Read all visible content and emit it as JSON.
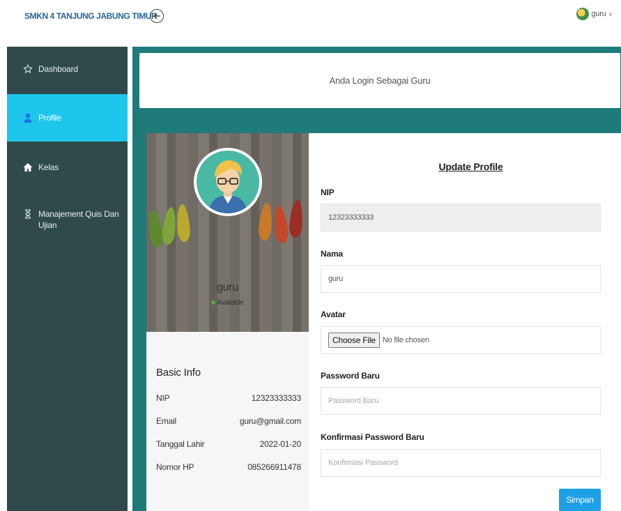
{
  "header": {
    "brand": "SMKN 4 TANJUNG JABUNG TIMUR",
    "back_icon": "back-arrow-circle-icon",
    "user_name": "guru",
    "caret": "∨"
  },
  "sidebar": {
    "items": [
      {
        "label": "Dashboard",
        "icon": "star-icon"
      },
      {
        "label": "Profile",
        "icon": "user-icon"
      },
      {
        "label": "Kelas",
        "icon": "home-icon"
      },
      {
        "label": "Manajement Quis Dan Ujian",
        "icon": "hourglass-icon"
      }
    ]
  },
  "notice": "Anda Login Sebagai Guru",
  "profile": {
    "name": "guru",
    "status": "Available",
    "basic_info_title": "Basic Info",
    "rows": [
      {
        "label": "NIP",
        "value": "12323333333"
      },
      {
        "label": "Email",
        "value": "guru@gmail.com"
      },
      {
        "label": "Tanggal Lahir",
        "value": "2022-01-20"
      },
      {
        "label": "Nomor HP",
        "value": "085266911478"
      }
    ]
  },
  "form": {
    "title": "Update Profile",
    "nip_label": "NIP",
    "nip_value": "12323333333",
    "nama_label": "Nama",
    "nama_value": "guru",
    "avatar_label": "Avatar",
    "choose_file": "Choose File",
    "no_file": "No file chosen",
    "password_label": "Password Baru",
    "password_placeholder": "Password Baru",
    "confirm_label": "Konfirmasi Password Baru",
    "confirm_placeholder": "Konfirmasi Password",
    "save_label": "Simpan"
  },
  "colors": {
    "sidebar_bg": "#2f4a4a",
    "sidebar_active": "#1ec6ec",
    "main_bg": "#1f7a7a",
    "brand": "#2a6496",
    "save_button": "#1ea0e6"
  }
}
